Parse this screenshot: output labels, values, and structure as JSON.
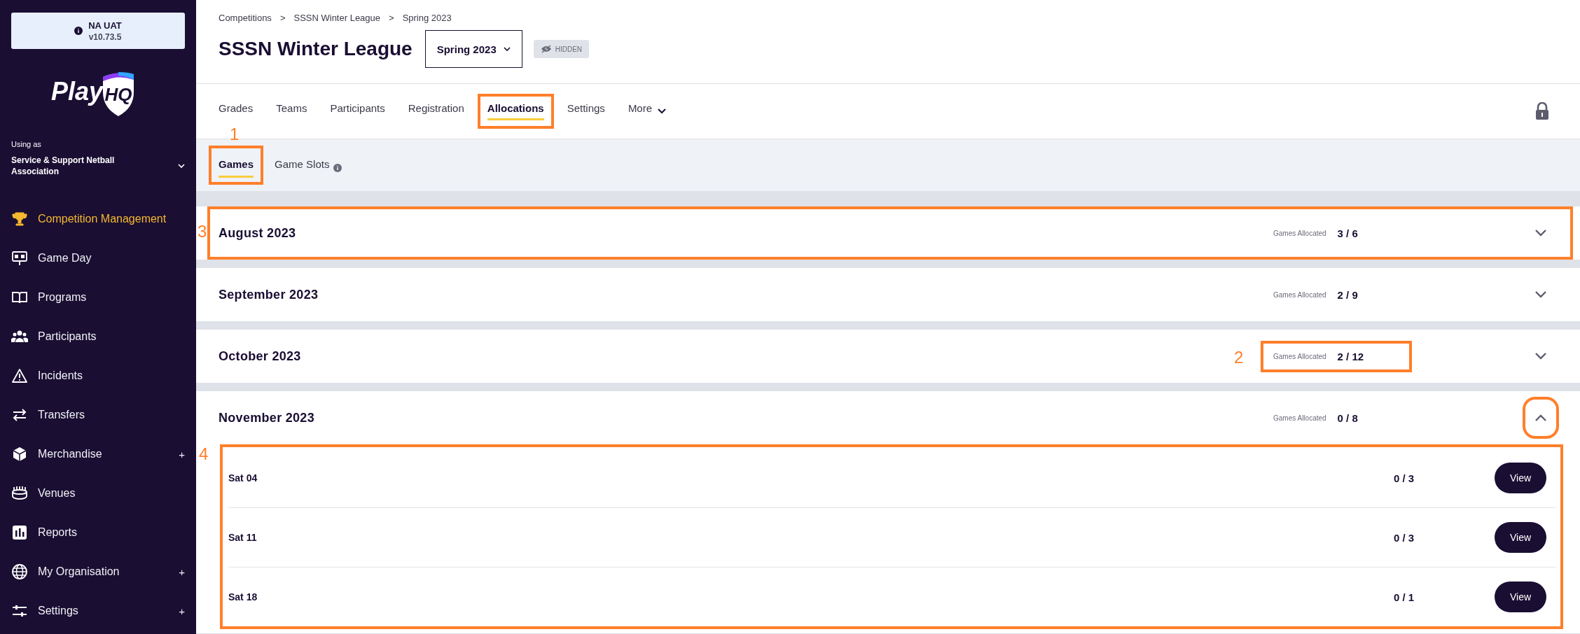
{
  "sidebar": {
    "env": {
      "name": "NA UAT",
      "version": "v10.73.5"
    },
    "logo": {
      "text": "Play",
      "badge": "HQ"
    },
    "account": {
      "label": "Using as",
      "name": "Service & Support Netball Association"
    },
    "items": [
      {
        "label": "Competition Management",
        "kind": "trophy",
        "selected": true
      },
      {
        "label": "Game Day",
        "kind": "scoreboard",
        "selected": false
      },
      {
        "label": "Programs",
        "kind": "book",
        "selected": false
      },
      {
        "label": "Participants",
        "kind": "people",
        "selected": false
      },
      {
        "label": "Incidents",
        "kind": "warning",
        "selected": false
      },
      {
        "label": "Transfers",
        "kind": "arrows",
        "selected": false
      },
      {
        "label": "Merchandise",
        "kind": "box",
        "selected": false,
        "suffix": "+"
      },
      {
        "label": "Venues",
        "kind": "stadium",
        "selected": false
      },
      {
        "label": "Reports",
        "kind": "chart",
        "selected": false
      },
      {
        "label": "My Organisation",
        "kind": "globe",
        "selected": false,
        "suffix": "+"
      },
      {
        "label": "Settings",
        "kind": "sliders",
        "selected": false,
        "suffix": "+"
      }
    ]
  },
  "breadcrumbs": [
    "Competitions",
    "SSSN Winter League",
    "Spring 2023"
  ],
  "breadcrumb_separator": ">",
  "title": "SSSN Winter League",
  "season_select": {
    "value": "Spring 2023"
  },
  "status_badge": "HIDDEN",
  "tabs": [
    {
      "label": "Grades",
      "selected": false,
      "highlighted": false
    },
    {
      "label": "Teams",
      "selected": false,
      "highlighted": false
    },
    {
      "label": "Participants",
      "selected": false,
      "highlighted": false
    },
    {
      "label": "Registration",
      "selected": false,
      "highlighted": false
    },
    {
      "label": "Allocations",
      "selected": true,
      "highlighted": true
    },
    {
      "label": "Settings",
      "selected": false,
      "highlighted": false
    },
    {
      "label": "More",
      "selected": false,
      "highlighted": false,
      "dropdown": true
    }
  ],
  "subtabs": [
    {
      "label": "Games",
      "selected": true,
      "info": false,
      "callout": {
        "label": "1"
      }
    },
    {
      "label": "Game Slots",
      "selected": false,
      "info": true
    }
  ],
  "months": [
    {
      "title": "August 2023",
      "allocated_label": "Games Allocated",
      "allocated": "3 / 6",
      "expanded": false,
      "toggle_highlighted": false,
      "row_callout": "3"
    },
    {
      "title": "September 2023",
      "allocated_label": "Games Allocated",
      "allocated": "2 / 9",
      "expanded": false,
      "toggle_highlighted": false
    },
    {
      "title": "October 2023",
      "allocated_label": "Games Allocated",
      "allocated": "2 / 12",
      "expanded": false,
      "toggle_highlighted": false,
      "count_callout": "2"
    },
    {
      "title": "November 2023",
      "allocated_label": "Games Allocated",
      "allocated": "0 / 8",
      "expanded": true,
      "toggle_highlighted": true,
      "days_callout": "4",
      "days": [
        {
          "day": "Sat 04",
          "allocated": "0 / 3",
          "action": "View"
        },
        {
          "day": "Sat 11",
          "allocated": "0 / 3",
          "action": "View"
        },
        {
          "day": "Sat 18",
          "allocated": "0 / 1",
          "action": "View"
        }
      ]
    }
  ]
}
